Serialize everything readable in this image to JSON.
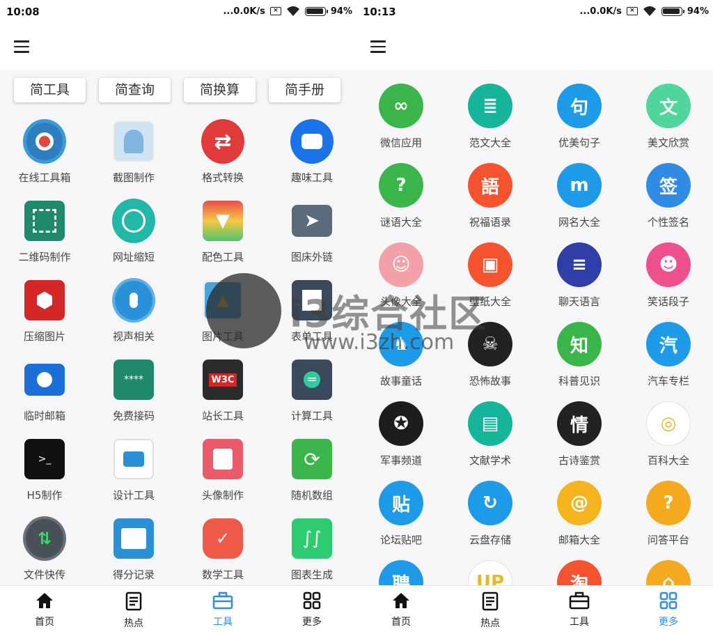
{
  "left": {
    "status": {
      "time": "10:08",
      "net": "...0.0K/s",
      "battery": "94%",
      "battery_level": 0.94
    },
    "tabs": [
      "简工具",
      "简查询",
      "简换算",
      "简手册"
    ],
    "tools": [
      {
        "label": "在线工具箱",
        "icon": "gear-icon"
      },
      {
        "label": "截图制作",
        "icon": "portrait-icon"
      },
      {
        "label": "格式转换",
        "icon": "swap-icon"
      },
      {
        "label": "趣味工具",
        "icon": "robot-icon"
      },
      {
        "label": "二维码制作",
        "icon": "qrcode-icon"
      },
      {
        "label": "网址缩短",
        "icon": "globe-icon"
      },
      {
        "label": "配色工具",
        "icon": "paint-bucket-icon"
      },
      {
        "label": "图床外链",
        "icon": "paper-plane-icon"
      },
      {
        "label": "压缩图片",
        "icon": "hexagon-icon"
      },
      {
        "label": "视声相关",
        "icon": "microphone-icon"
      },
      {
        "label": "图片工具",
        "icon": "picture-icon"
      },
      {
        "label": "表单工具",
        "icon": "form-icon"
      },
      {
        "label": "临时邮箱",
        "icon": "envelope-icon"
      },
      {
        "label": "免费接码",
        "icon": "keypad-icon"
      },
      {
        "label": "站长工具",
        "icon": "w3c-icon"
      },
      {
        "label": "计算工具",
        "icon": "calculator-icon"
      },
      {
        "label": "H5制作",
        "icon": "terminal-icon"
      },
      {
        "label": "设计工具",
        "icon": "camera-icon"
      },
      {
        "label": "头像制作",
        "icon": "cat-icon"
      },
      {
        "label": "随机数组",
        "icon": "refresh-icon"
      },
      {
        "label": "文件快传",
        "icon": "transfer-arrows-icon"
      },
      {
        "label": "得分记录",
        "icon": "calendar-icon"
      },
      {
        "label": "数学工具",
        "icon": "math-icon"
      },
      {
        "label": "图表生成",
        "icon": "chart-icon"
      }
    ],
    "nav": [
      {
        "label": "首页",
        "icon": "home-icon"
      },
      {
        "label": "热点",
        "icon": "news-icon"
      },
      {
        "label": "工具",
        "icon": "toolbox-icon"
      },
      {
        "label": "更多",
        "icon": "grid-icon"
      }
    ]
  },
  "right": {
    "status": {
      "time": "10:13",
      "net": "...0.0K/s",
      "battery": "94%",
      "battery_level": 0.94
    },
    "items": [
      {
        "label": "微信应用",
        "color": "#3ab54a",
        "glyph": "∞"
      },
      {
        "label": "范文大全",
        "color": "#14b59a",
        "glyph": "≣"
      },
      {
        "label": "优美句子",
        "color": "#1e9be8",
        "glyph": "句"
      },
      {
        "label": "美文欣赏",
        "color": "#4ed69c",
        "glyph": "文"
      },
      {
        "label": "谜语大全",
        "color": "#3ab54a",
        "glyph": "?"
      },
      {
        "label": "祝福语录",
        "color": "#f5522e",
        "glyph": "語"
      },
      {
        "label": "网名大全",
        "color": "#1e9be8",
        "glyph": "m"
      },
      {
        "label": "个性签名",
        "color": "#2e8be6",
        "glyph": "签"
      },
      {
        "label": "头像大全",
        "color": "#f3a0a8",
        "glyph": "☺"
      },
      {
        "label": "壁纸大全",
        "color": "#f5522e",
        "glyph": "▣"
      },
      {
        "label": "聊天语言",
        "color": "#2f3ea8",
        "glyph": "≡"
      },
      {
        "label": "笑话段子",
        "color": "#ef4f8c",
        "glyph": "☻"
      },
      {
        "label": "故事童话",
        "color": "#1e9be8",
        "glyph": "♞"
      },
      {
        "label": "恐怖故事",
        "color": "#222222",
        "glyph": "☠"
      },
      {
        "label": "科普见识",
        "color": "#3ab54a",
        "glyph": "知"
      },
      {
        "label": "汽车专栏",
        "color": "#1e9be8",
        "glyph": "汽"
      },
      {
        "label": "军事频道",
        "color": "#1d1d1d",
        "glyph": "✪"
      },
      {
        "label": "文献学术",
        "color": "#14b59a",
        "glyph": "▤"
      },
      {
        "label": "古诗鉴赏",
        "color": "#222222",
        "glyph": "情"
      },
      {
        "label": "百科大全",
        "color": "#ffffff",
        "glyph": "◎"
      },
      {
        "label": "论坛贴吧",
        "color": "#1e9be8",
        "glyph": "贴"
      },
      {
        "label": "云盘存储",
        "color": "#1e9be8",
        "glyph": "↻"
      },
      {
        "label": "邮箱大全",
        "color": "#f5b41e",
        "glyph": "@"
      },
      {
        "label": "问答平台",
        "color": "#f5a91e",
        "glyph": "?"
      },
      {
        "label": "",
        "color": "#1e9be8",
        "glyph": "聘"
      },
      {
        "label": "",
        "color": "#ffffff",
        "glyph": "UP"
      },
      {
        "label": "",
        "color": "#f5522e",
        "glyph": "淘"
      },
      {
        "label": "",
        "color": "#f5a91e",
        "glyph": "⌂"
      }
    ],
    "nav": [
      {
        "label": "首页",
        "icon": "home-icon"
      },
      {
        "label": "热点",
        "icon": "news-icon"
      },
      {
        "label": "工具",
        "icon": "toolbox-icon"
      },
      {
        "label": "更多",
        "icon": "grid-icon"
      }
    ]
  },
  "watermark": {
    "title": "i3综合社区",
    "url": "www.i3zh.com"
  },
  "colors": {
    "accent": "#2e8be6",
    "background": "#f6f6f8"
  }
}
